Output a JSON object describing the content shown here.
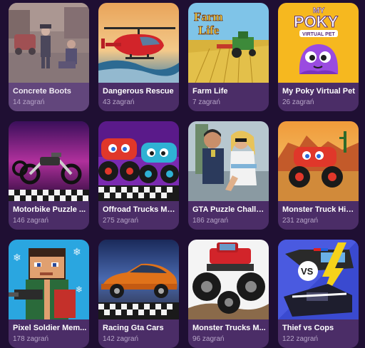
{
  "games": [
    {
      "title": "Concrete Boots",
      "plays": "14 zagrań",
      "thumbnail": "concrete-boots-thumbnail"
    },
    {
      "title": "Dangerous Rescue",
      "plays": "43 zagrań",
      "thumbnail": "dangerous-rescue-thumbnail"
    },
    {
      "title": "Farm Life",
      "plays": "7 zagrań",
      "thumbnail": "farm-life-thumbnail",
      "thumb_text": "Farm Life"
    },
    {
      "title": "My Poky Virtual Pet",
      "plays": "26 zagrań",
      "thumbnail": "my-poky-thumbnail",
      "thumb_text_1": "MY",
      "thumb_text_2": "POKY",
      "thumb_text_3": "VIRTUAL PET"
    },
    {
      "title": "Motorbike Puzzle ...",
      "plays": "146 zagrań",
      "thumbnail": "motorbike-puzzle-thumbnail"
    },
    {
      "title": "Offroad Trucks Me...",
      "plays": "275 zagrań",
      "thumbnail": "offroad-trucks-thumbnail"
    },
    {
      "title": "GTA Puzzle Challe...",
      "plays": "186 zagrań",
      "thumbnail": "gta-puzzle-thumbnail"
    },
    {
      "title": "Monster Truck Hid...",
      "plays": "231 zagrań",
      "thumbnail": "monster-truck-hidden-thumbnail"
    },
    {
      "title": "Pixel Soldier Mem...",
      "plays": "178 zagrań",
      "thumbnail": "pixel-soldier-thumbnail"
    },
    {
      "title": "Racing Gta Cars",
      "plays": "142 zagrań",
      "thumbnail": "racing-gta-cars-thumbnail"
    },
    {
      "title": "Monster Trucks M...",
      "plays": "96 zagrań",
      "thumbnail": "monster-trucks-memory-thumbnail"
    },
    {
      "title": "Thief vs Cops",
      "plays": "122 zagrań",
      "thumbnail": "thief-vs-cops-thumbnail",
      "thumb_text": "VS"
    }
  ],
  "colors": {
    "page_background": "#1f0f33",
    "card_background": "#4b2d67",
    "title_text": "#ffffff",
    "plays_text": "#b7a6c8"
  }
}
